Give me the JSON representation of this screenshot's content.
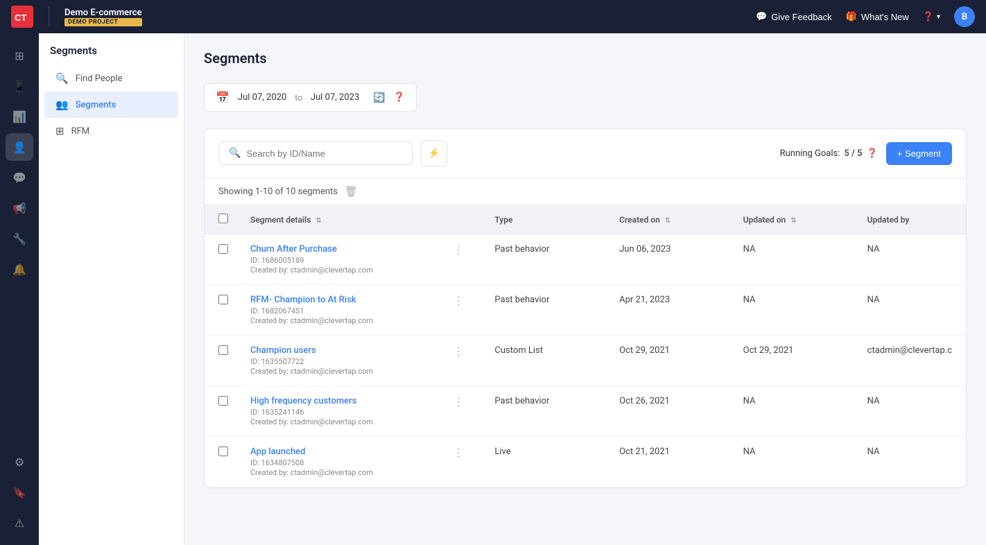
{
  "topNav": {
    "logoText": "CleverTap",
    "projectName": "Demo E-commerce",
    "projectBadge": "DEMO PROJECT",
    "giveFeedbackLabel": "Give Feedback",
    "whatsNewLabel": "What's New",
    "userInitial": "B"
  },
  "sidebar": {
    "title": "Segments",
    "items": [
      {
        "id": "find-people",
        "label": "Find People",
        "icon": "🔍"
      },
      {
        "id": "segments",
        "label": "Segments",
        "icon": "👥"
      },
      {
        "id": "rfm",
        "label": "RFM",
        "icon": "⊞"
      }
    ]
  },
  "iconBar": {
    "items": [
      {
        "id": "dashboard",
        "icon": "⊞",
        "active": false
      },
      {
        "id": "phone",
        "icon": "📞",
        "active": false
      },
      {
        "id": "analytics",
        "icon": "📊",
        "active": false
      },
      {
        "id": "users",
        "icon": "👤",
        "active": true
      },
      {
        "id": "messages",
        "icon": "💬",
        "active": false
      },
      {
        "id": "campaigns",
        "icon": "📢",
        "active": false
      },
      {
        "id": "integrations",
        "icon": "⚙",
        "active": false
      },
      {
        "id": "notifications",
        "icon": "🔔",
        "active": false
      }
    ],
    "bottomItems": [
      {
        "id": "settings",
        "icon": "⚙"
      },
      {
        "id": "bookmark",
        "icon": "🔖"
      },
      {
        "id": "warning",
        "icon": "⚠"
      }
    ]
  },
  "page": {
    "title": "Segments",
    "dateRange": {
      "from": "Jul 07, 2020",
      "to": "Jul 07, 2023",
      "separator": "to"
    },
    "search": {
      "placeholder": "Search by ID/Name"
    },
    "runningGoals": {
      "label": "Running Goals:",
      "value": "5 / 5"
    },
    "addSegmentLabel": "+ Segment",
    "showingCount": "Showing 1-10 of 10 segments",
    "table": {
      "columns": [
        {
          "id": "details",
          "label": "Segment details",
          "sortable": true
        },
        {
          "id": "type",
          "label": "Type",
          "sortable": false
        },
        {
          "id": "created",
          "label": "Created on",
          "sortable": true
        },
        {
          "id": "updated",
          "label": "Updated on",
          "sortable": true
        },
        {
          "id": "updatedby",
          "label": "Updated by",
          "sortable": false
        }
      ],
      "rows": [
        {
          "name": "Churn After Purchase",
          "id": "ID: 1686005189",
          "creator": "Created by: ctadmin@clevertap.com",
          "type": "Past behavior",
          "createdOn": "Jun 06, 2023",
          "updatedOn": "NA",
          "updatedBy": "NA"
        },
        {
          "name": "RFM- Champion to At Risk",
          "id": "ID: 1682067451",
          "creator": "Created by: ctadmin@clevertap.com",
          "type": "Past behavior",
          "createdOn": "Apr 21, 2023",
          "updatedOn": "NA",
          "updatedBy": "NA"
        },
        {
          "name": "Champion users",
          "id": "ID: 1635507722",
          "creator": "Created by: ctadmin@clevertap.com",
          "type": "Custom List",
          "createdOn": "Oct 29, 2021",
          "updatedOn": "Oct 29, 2021",
          "updatedBy": "ctadmin@clevertap.c"
        },
        {
          "name": "High frequency customers",
          "id": "ID: 1635241146",
          "creator": "Created by: ctadmin@clevertap.com",
          "type": "Past behavior",
          "createdOn": "Oct 26, 2021",
          "updatedOn": "NA",
          "updatedBy": "NA"
        },
        {
          "name": "App launched",
          "id": "ID: 1634807508",
          "creator": "Created by: ctadmin@clevertap.com",
          "type": "Live",
          "createdOn": "Oct 21, 2021",
          "updatedOn": "NA",
          "updatedBy": "NA"
        }
      ]
    }
  }
}
